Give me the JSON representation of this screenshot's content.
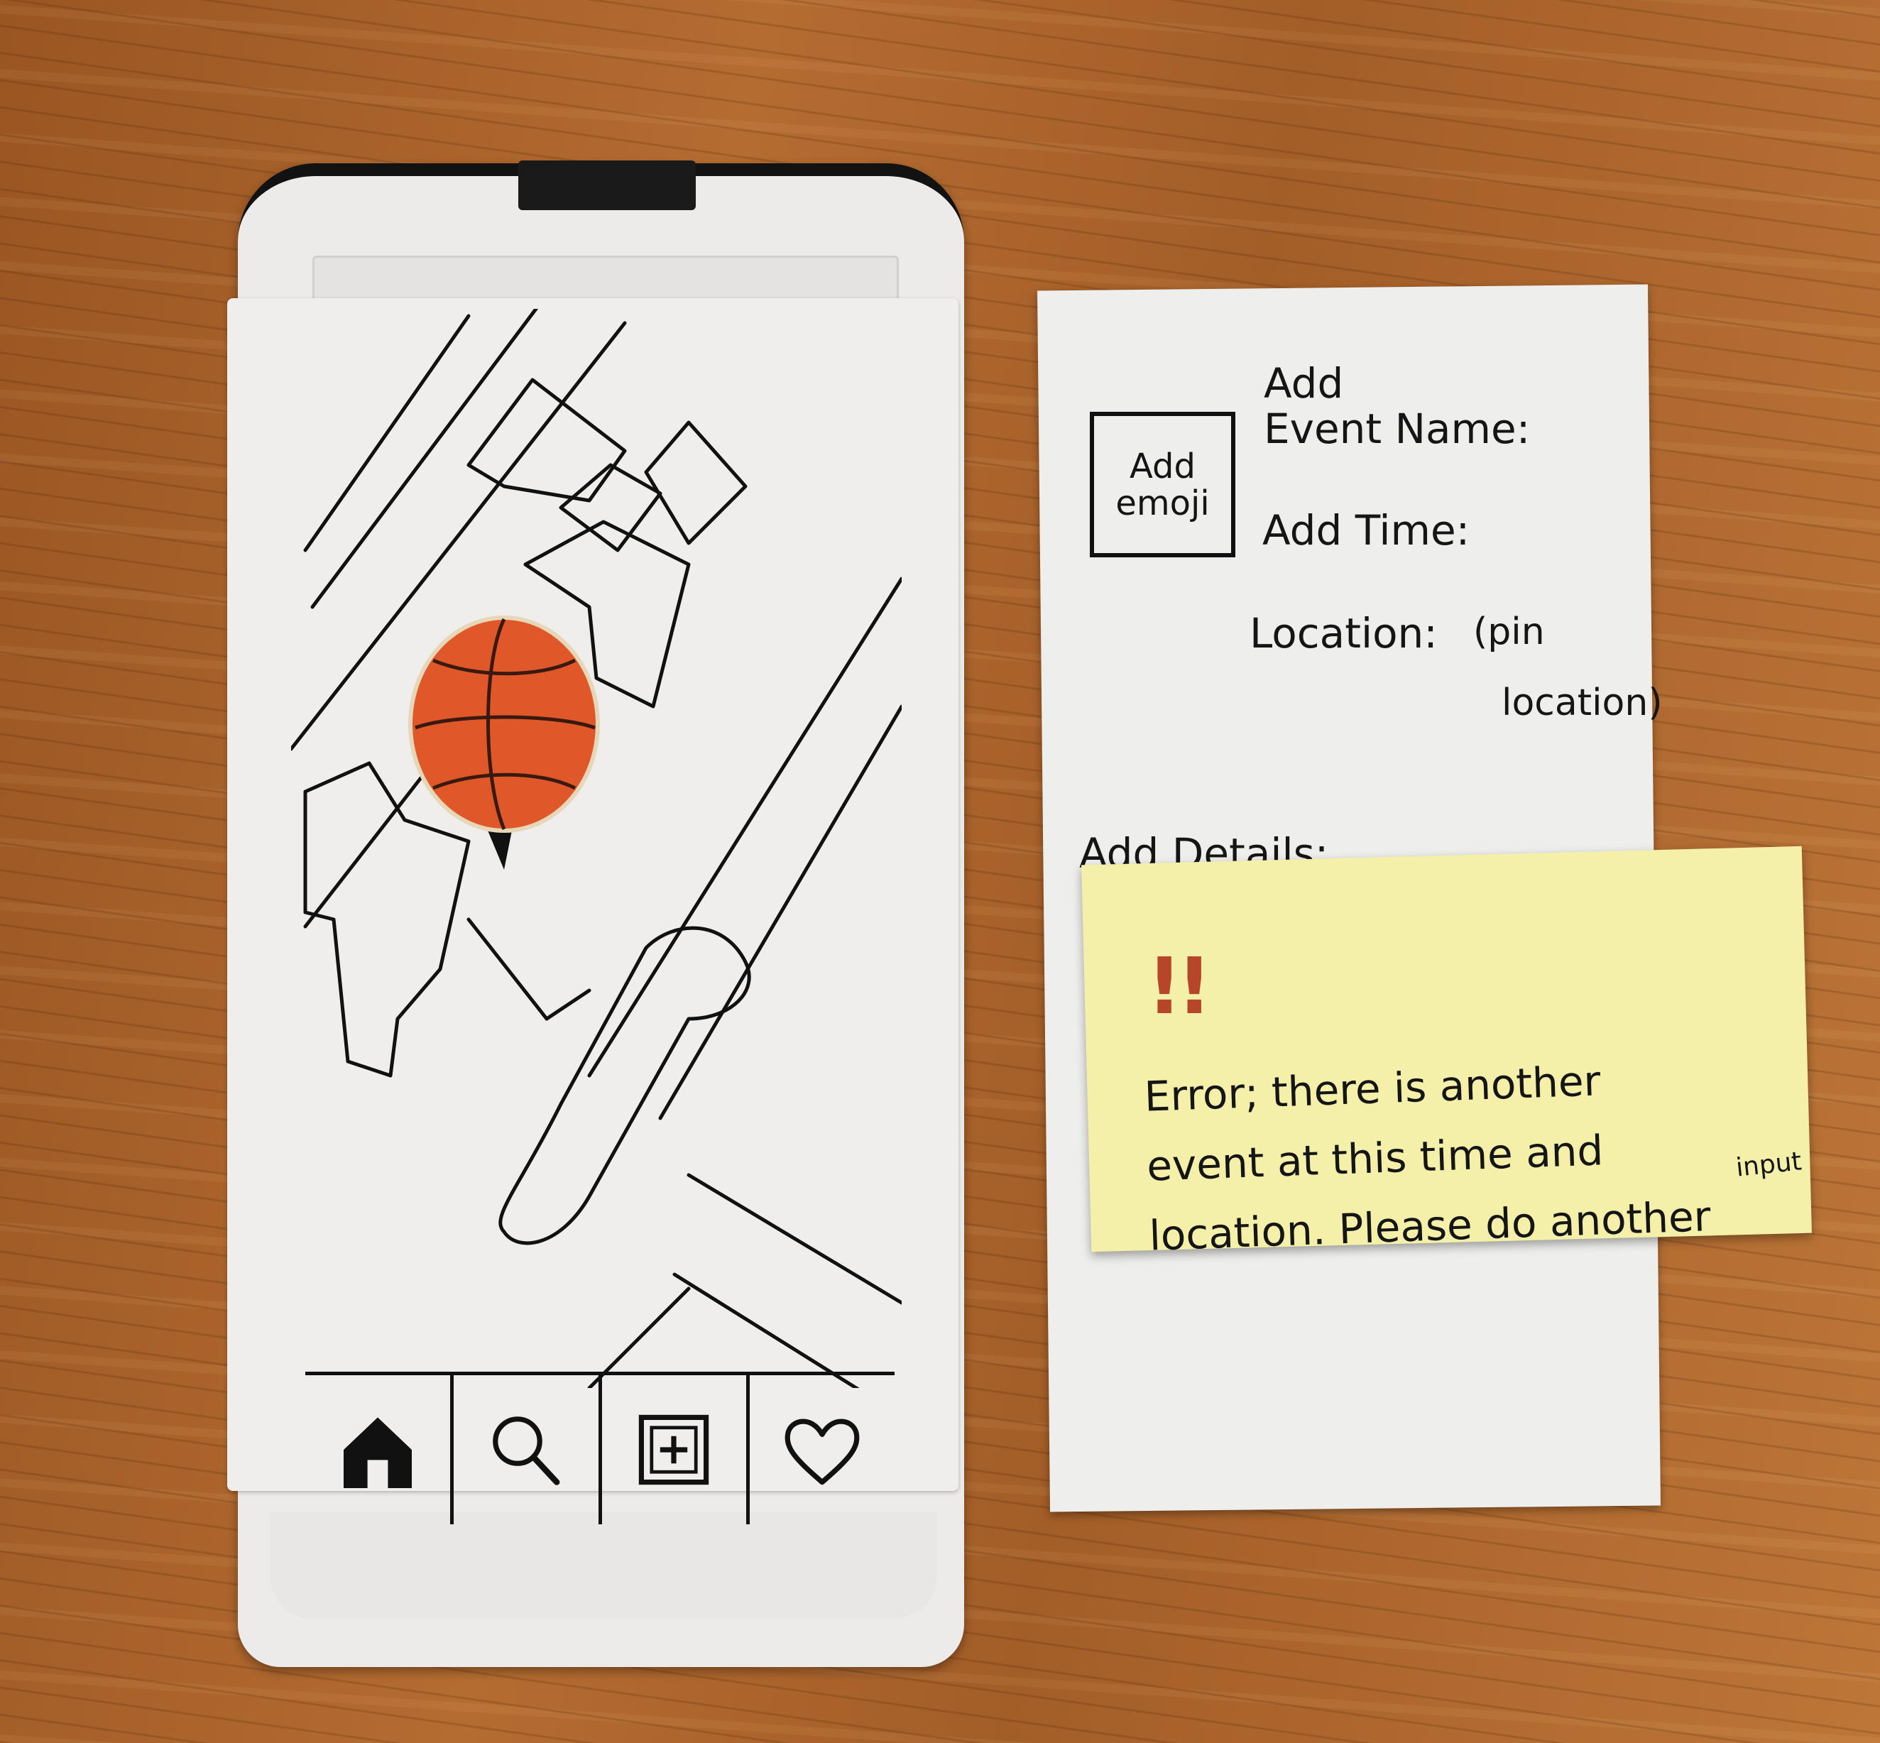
{
  "phone": {
    "tab_bar": {
      "items": [
        {
          "icon": "home-icon",
          "active": true
        },
        {
          "icon": "search-icon",
          "active": false
        },
        {
          "icon": "add-box-icon",
          "active": false
        },
        {
          "icon": "heart-icon",
          "active": false
        }
      ]
    },
    "map": {
      "pin": {
        "icon": "basketball-pin-icon",
        "color": "#e0582a"
      }
    }
  },
  "form": {
    "emoji_button": {
      "line1": "Add",
      "line2": "emoji"
    },
    "event_name_label": {
      "line1": "Add",
      "line2": "Event Name:"
    },
    "time_label": "Add Time:",
    "location_label": "Location:",
    "location_note": {
      "line1": "(pin",
      "line2": "location)"
    },
    "details_label": "Add Details:"
  },
  "error_note": {
    "icon": "double-exclamation-icon",
    "marks": "!!",
    "line1": "Error; there is another",
    "line2": "event at this time and",
    "line3": "location. Please do another",
    "superscript": "input",
    "background": "#f4efa9",
    "accent": "#b5462a"
  }
}
